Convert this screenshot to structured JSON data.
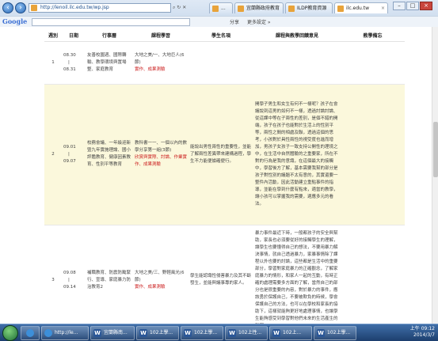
{
  "browser": {
    "address": "http://lenoil.ilc.edu.tw/wp.jsp",
    "tabs": [
      {
        "label": "..."
      },
      {
        "label": "宜蘭縣政府教育"
      },
      {
        "label": "ILDP教育資源"
      },
      {
        "label": "ilc.edu.tw"
      }
    ],
    "active_tab": 3,
    "google_label": "Google",
    "toolbar_items": [
      "分享",
      "更多設定 »"
    ]
  },
  "table": {
    "headers": [
      "週別",
      "日期",
      "行事曆",
      "課程學習",
      "學生名項",
      "課程與教學回饋意見",
      "教學備忘"
    ],
    "rows": [
      {
        "week": "1",
        "date_start": "08.30",
        "date_sep": "|",
        "date_end": "08.31",
        "calendar": "友善校園週、國際轉輸、教學環境與置場整、家庭教育",
        "course": "大地之美/一、大地巨人(6節)",
        "course_link": "實作、成果測驗",
        "student": "",
        "feedback": "",
        "memo": ""
      },
      {
        "week": "2",
        "date_start": "09.01",
        "date_sep": "|",
        "date_end": "09.07",
        "calendar": "校務會議、一年級迎新暨九年實施理論、國小評鑑教育、健康因素教育、性別平等教育",
        "course": "教科書一一、一個以內的數學分享第一組(3節)",
        "course_link": "欣賞與實際、討論、作業實作、成果測驗",
        "student": "能說出男性兩性的重要性，並能了解兩性差異帶來建構過程，學生不力能便據確便行。",
        "feedback": "開學子男生和女生有何不一樣呢？孩子在會議說到這男的如何不一樣，透過討論討論、從這課中等在子兩性的差別，是個不錯的開端，孩子在孩子也能對於生活上的性別平等，兩性之間的相處及聯，透過這個的思考，小孩對於具性兩性的視受度也進而增加，男孩子女孩子一致支持公開性的理境之中，在生活中自然體驗的之重要家，所在不對的行為是我的意識，在這個最大的接觸中，學習後方了解，基本需要我幫的部分是孩子對性別的議題不太有意的，其實還要一整件內活動，因此活動建立重點事件的指導，並能在學到什麼有點來，適當的教學，讓小孩可以掌握我的需要，適應多元的看法。",
        "memo": ""
      },
      {
        "week": "3",
        "date_start": "09.08",
        "date_sep": "|",
        "date_end": "09.14",
        "calendar": "補職教育、防震防颱緊行、宣導、家庭暴力防治教育2",
        "course": "大地之美/三、野輕風光(6節)",
        "course_link": "實作、成果測驗",
        "student": "學生能認識性侵害暴力及其不斷發生，並能與議事專的家人。",
        "feedback": "暴力事件最近下時，一般都孩子的安全與幫助，家長也必須要從好的接觸學生的理解，讓學生也要懂得自己的想法，不要用暴力解決事情，就自己透過暴力，家暴事情除了課程以外也要的討論，這些都是生活中的重要部分，學習對家庭暴力的正確觀念，了解家庭暴力的情形，和家人一起的互動，有時正確的處理需要多方面的了解，當然自己的部分也是很重要的內容，對於暴力的事件，應該勇於保護自己，不要被欺負的時候，學會保護自己的方法，也可以在學校和家長的協助下，這樣就能夠更好地處理事情，也讓學生能夠感受到學習對他們未來的生活產生的影響。",
        "memo": ""
      }
    ]
  },
  "taskbar": {
    "items": [
      {
        "label": "",
        "icon": "ie-icon"
      },
      {
        "label": "http://le...",
        "icon": "ie-icon"
      },
      {
        "label": "宜蘭縣南...",
        "icon": "word-icon"
      },
      {
        "label": "102上學...",
        "icon": "word-icon"
      },
      {
        "label": "102上學...",
        "icon": "word-icon"
      },
      {
        "label": "102上性...",
        "icon": "word-icon"
      },
      {
        "label": "102上...",
        "icon": "word-icon"
      },
      {
        "label": "102上學...",
        "icon": "word-icon"
      }
    ],
    "time": "上午 09:12",
    "date": "2014/3/7"
  }
}
